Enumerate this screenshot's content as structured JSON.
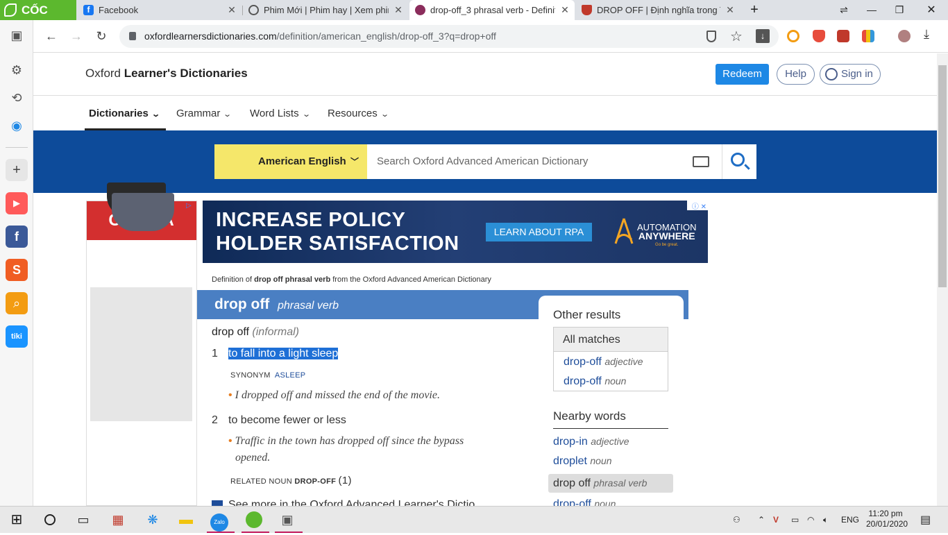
{
  "browser": {
    "logo": "CỐC CỐC",
    "tabs": [
      {
        "title": "Facebook",
        "icon": "facebook-icon",
        "color": "#1877f2"
      },
      {
        "title": "Phim Mới | Phim hay | Xem phim n",
        "icon": "film-reel-icon",
        "color": "#555555"
      },
      {
        "title": "drop-off_3 phrasal verb - Definitio",
        "icon": "oxford-icon",
        "color": "#8b2d5c"
      },
      {
        "title": "DROP OFF | Định nghĩa trong Từ đ",
        "icon": "cambridge-icon",
        "color": "#c0392b"
      }
    ],
    "new_tab": "+",
    "url_host": "oxfordlearnersdictionaries.com",
    "url_path": "/definition/american_english/drop-off_3?q=drop+off"
  },
  "site": {
    "title_plain": "Oxford ",
    "title_bold": "Learner's Dictionaries",
    "redeem": "Redeem",
    "help": "Help",
    "sign_in": "Sign in",
    "nav": [
      "Dictionaries",
      "Grammar",
      "Word Lists",
      "Resources"
    ]
  },
  "search": {
    "dictionary": "American English",
    "placeholder": "Search Oxford Advanced American Dictionary"
  },
  "ads": {
    "canifa_brand": "CANIFA",
    "rpa_line1": "INCREASE POLICY",
    "rpa_line2": "HOLDER SATISFACTION",
    "rpa_cta": "LEARN ABOUT RPA",
    "rpa_brand1": "AUTOMATION",
    "rpa_brand2": "ANYWHERE",
    "rpa_tagline": "Go be great."
  },
  "entry": {
    "source_prefix": "Definition of ",
    "source_word": "drop off phrasal verb",
    "source_suffix": " from the Oxford Advanced American Dictionary",
    "headword": "drop off",
    "pos": "phrasal verb",
    "sense_head": "drop off",
    "register": "(informal)",
    "senses": [
      {
        "num": "1",
        "definition": "to fall into a light sleep",
        "synonym_label": "SYNONYM",
        "synonym": "ASLEEP",
        "examples": [
          "I dropped off and missed the end of the movie."
        ]
      },
      {
        "num": "2",
        "definition": "to become fewer or less",
        "examples_line1": "Traffic in the town has dropped off since the bypass",
        "examples_line2": "opened.",
        "related_label": "RELATED NOUN",
        "related": "DROP-OFF",
        "related_num": "(1)"
      }
    ],
    "footer_peek": "See more in the Oxford Advanced Learner's Dictio"
  },
  "other_results": {
    "title": "Other results",
    "all_matches": "All matches",
    "matches": [
      {
        "word": "drop-off",
        "pos": "adjective"
      },
      {
        "word": "drop-off",
        "pos": "noun"
      }
    ],
    "nearby_title": "Nearby words",
    "nearby": [
      {
        "word": "drop-in",
        "pos": "adjective"
      },
      {
        "word": "droplet",
        "pos": "noun"
      },
      {
        "word": "drop off",
        "pos": "phrasal verb"
      },
      {
        "word": "drop-off",
        "pos": "noun"
      }
    ]
  },
  "taskbar": {
    "lang": "ENG",
    "time": "11:20 pm",
    "date": "20/01/2020",
    "zalo": "Zalo"
  },
  "colors": {
    "oxford_blue": "#0d4b9a",
    "headbar_blue": "#4a7fc3",
    "dict_yellow": "#f5e76a",
    "coccoc_green": "#5cb82e"
  }
}
